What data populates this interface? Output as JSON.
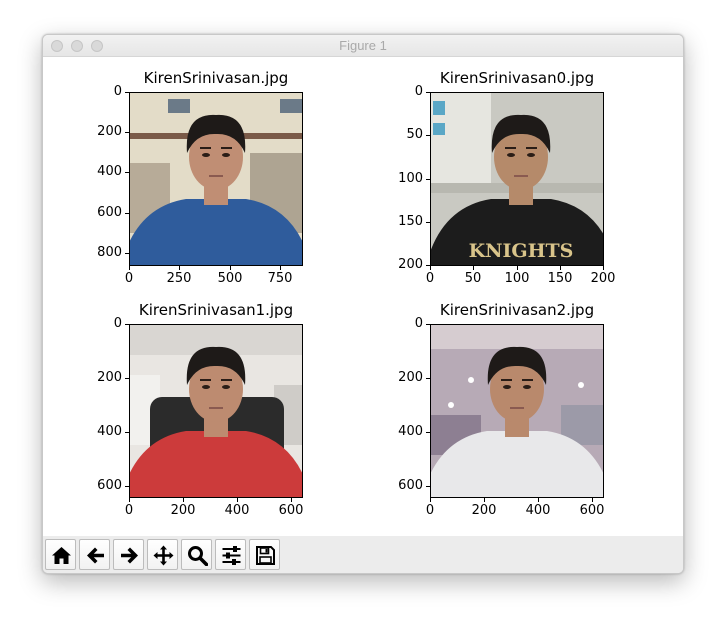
{
  "window": {
    "title": "Figure 1"
  },
  "subplots": [
    {
      "title": "KirenSrinivasan.jpg",
      "x_ticks": [
        "0",
        "250",
        "500",
        "750"
      ],
      "y_ticks": [
        "0",
        "200",
        "400",
        "600",
        "800"
      ],
      "x_max": 860,
      "y_max": 860,
      "x_vals": [
        0,
        250,
        500,
        750
      ],
      "y_vals": [
        0,
        200,
        400,
        600,
        800
      ],
      "shirt_color": "#2f5c9c",
      "bg_color": "#e3dcc8",
      "skin_color": "#c08e74"
    },
    {
      "title": "KirenSrinivasan0.jpg",
      "x_ticks": [
        "0",
        "50",
        "100",
        "150",
        "200"
      ],
      "y_ticks": [
        "0",
        "50",
        "100",
        "150",
        "200"
      ],
      "x_max": 200,
      "y_max": 200,
      "x_vals": [
        0,
        50,
        100,
        150,
        200
      ],
      "y_vals": [
        0,
        50,
        100,
        150,
        200
      ],
      "shirt_color": "#1c1c1c",
      "bg_color": "#c9c9c2",
      "skin_color": "#b58a6a",
      "shirt_text": "KNIGHTS"
    },
    {
      "title": "KirenSrinivasan1.jpg",
      "x_ticks": [
        "0",
        "200",
        "400",
        "600"
      ],
      "y_ticks": [
        "0",
        "200",
        "400",
        "600"
      ],
      "x_max": 640,
      "y_max": 640,
      "x_vals": [
        0,
        200,
        400,
        600
      ],
      "y_vals": [
        0,
        200,
        400,
        600
      ],
      "shirt_color": "#cc3b3b",
      "bg_color": "#e9e6e2",
      "skin_color": "#bd8b70"
    },
    {
      "title": "KirenSrinivasan2.jpg",
      "x_ticks": [
        "0",
        "200",
        "400",
        "600"
      ],
      "y_ticks": [
        "0",
        "200",
        "400",
        "600"
      ],
      "x_max": 640,
      "y_max": 640,
      "x_vals": [
        0,
        200,
        400,
        600
      ],
      "y_vals": [
        0,
        200,
        400,
        600
      ],
      "shirt_color": "#e8e8ea",
      "bg_color": "#b7aab6",
      "skin_color": "#b9896c"
    }
  ],
  "toolbar": {
    "buttons": [
      "home-icon",
      "back-arrow-icon",
      "forward-arrow-icon",
      "pan-move-icon",
      "zoom-magnifier-icon",
      "configure-subplots-icon",
      "save-disk-icon"
    ]
  }
}
